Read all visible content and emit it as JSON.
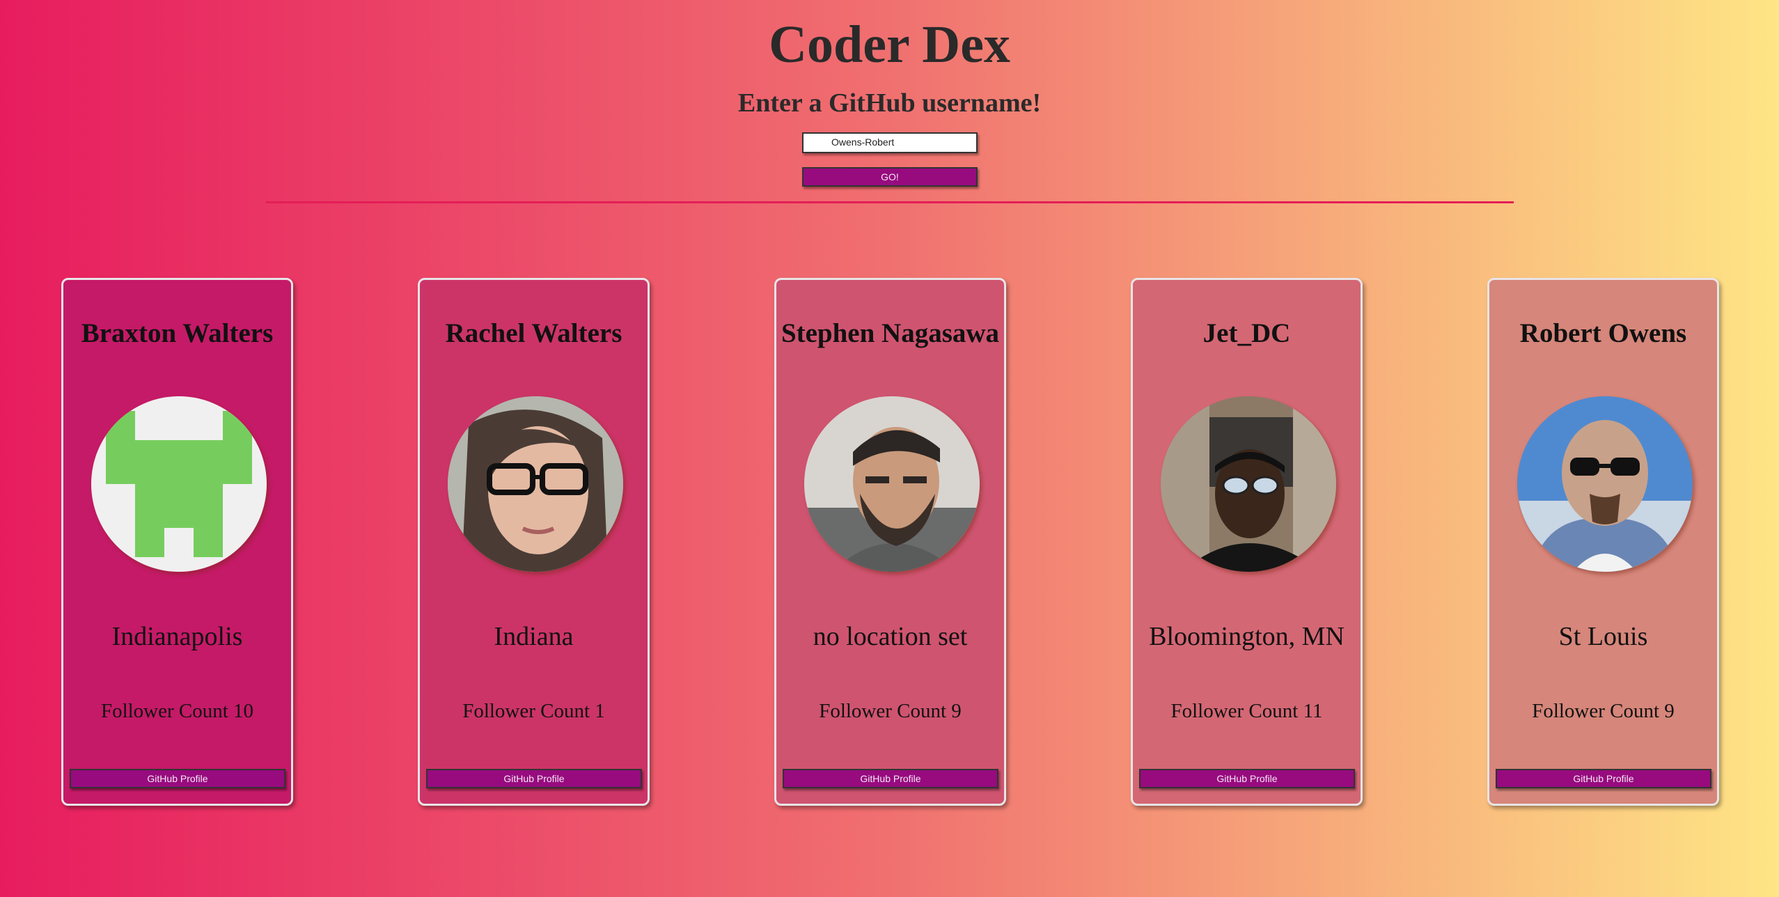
{
  "header": {
    "title": "Coder Dex",
    "subtitle": "Enter a GitHub username!"
  },
  "search": {
    "value": "Owens-Robert",
    "button_label": "GO!"
  },
  "cards": [
    {
      "name": "Braxton Walters",
      "location": "Indianapolis",
      "followers": "Follower Count 10",
      "button_label": "GitHub Profile",
      "avatar": "identicon-avatar"
    },
    {
      "name": "Rachel Walters",
      "location": "Indiana",
      "followers": "Follower Count 1",
      "button_label": "GitHub Profile",
      "avatar": "photo-avatar"
    },
    {
      "name": "Stephen Nagasawa",
      "location": "no location set",
      "followers": "Follower Count 9",
      "button_label": "GitHub Profile",
      "avatar": "photo-avatar"
    },
    {
      "name": "Jet_DC",
      "location": "Bloomington, MN",
      "followers": "Follower Count 11",
      "button_label": "GitHub Profile",
      "avatar": "photo-avatar"
    },
    {
      "name": "Robert Owens",
      "location": "St Louis",
      "followers": "Follower Count 9",
      "button_label": "GitHub Profile",
      "avatar": "photo-avatar"
    }
  ],
  "colors": {
    "background_start": "#e71c5f",
    "background_end": "#fee585",
    "button": "#970b7f",
    "divider": "#e41e57"
  }
}
